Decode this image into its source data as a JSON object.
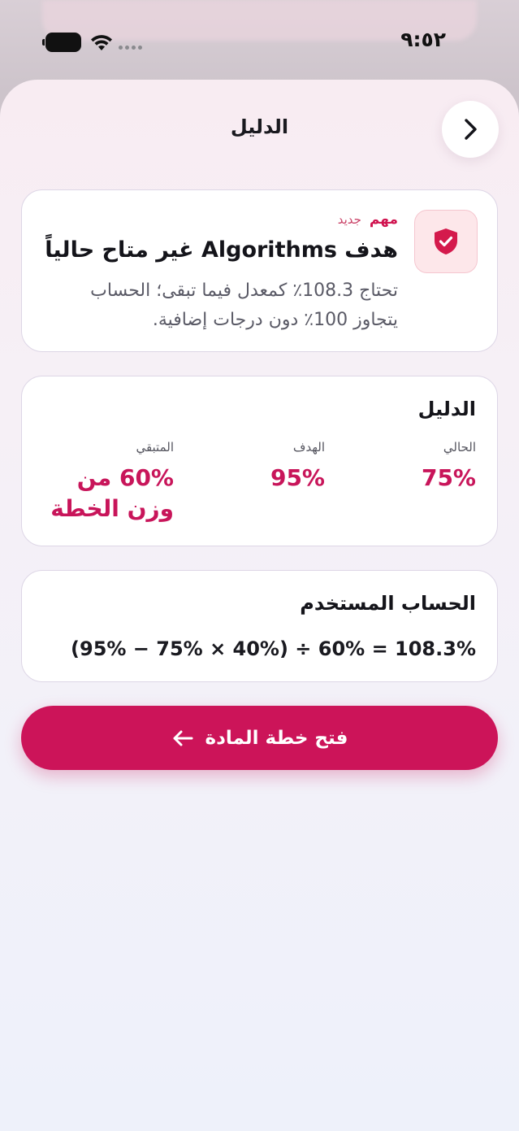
{
  "status_bar": {
    "time": "٩:٥٢"
  },
  "sheet": {
    "title": "الدليل",
    "back_icon": "chevron-right-icon"
  },
  "alert": {
    "tag_important": "مهم",
    "tag_new": "جديد",
    "title": "هدف Algorithms غير متاح حالياً",
    "body": "تحتاج 108.3٪ كمعدل فيما تبقى؛ الحساب يتجاوز 100٪ دون درجات إضافية.",
    "icon": "shield-check-icon",
    "accent": "#d0134f"
  },
  "evidence": {
    "title": "الدليل",
    "current_label": "الحالي",
    "current_value": "75%",
    "target_label": "الهدف",
    "target_value": "95%",
    "remaining_label": "المتبقي",
    "remaining_value": "60% من وزن الخطة"
  },
  "calculation": {
    "title": "الحساب المستخدم",
    "formula": "(95% − 75% × 40%) ÷ 60% = 108.3%"
  },
  "cta": {
    "label": "فتح خطة المادة",
    "icon": "arrow-left-icon",
    "color": "#cc1459"
  }
}
